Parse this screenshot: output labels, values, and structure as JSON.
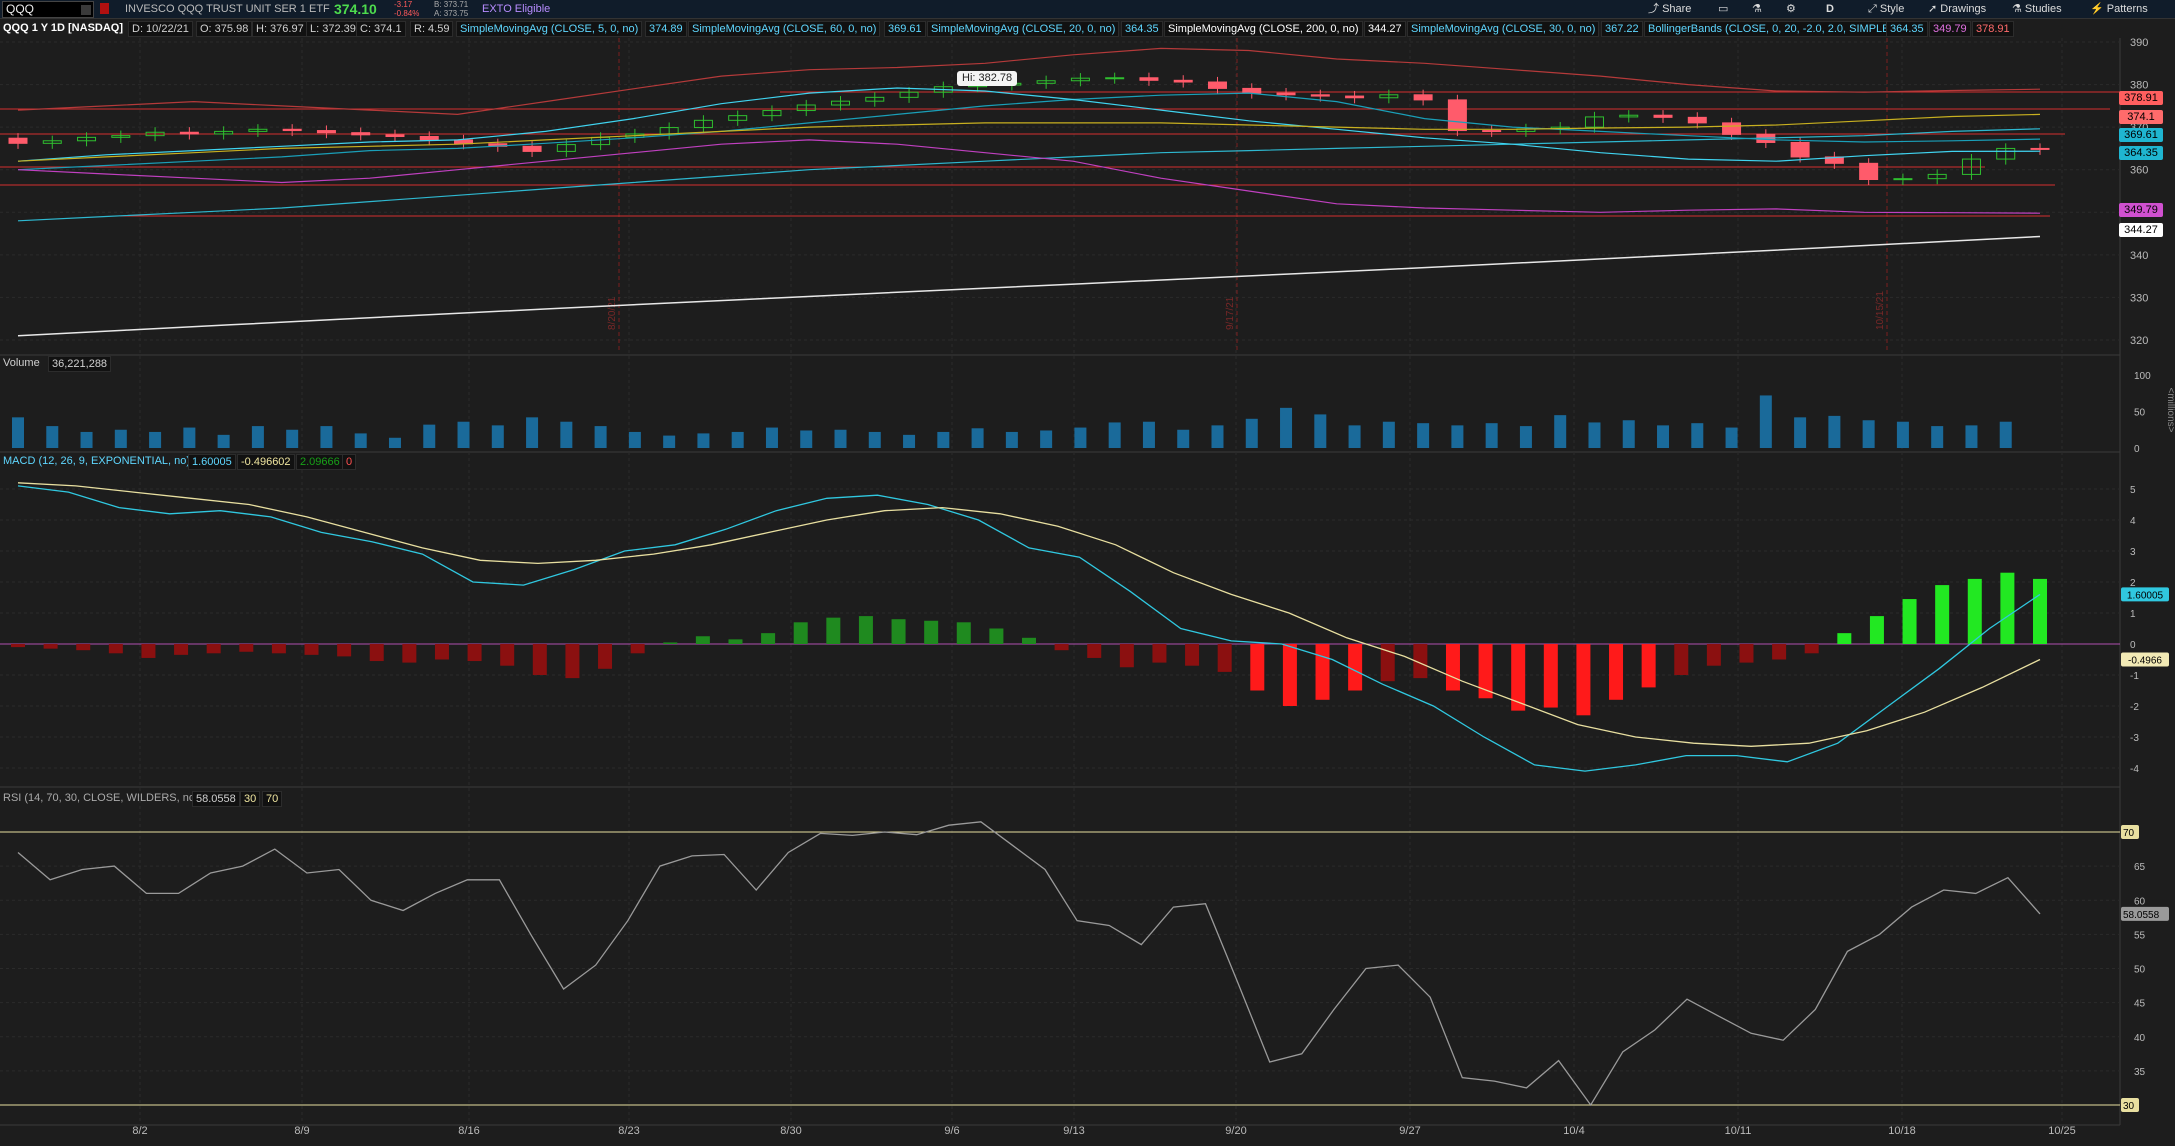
{
  "topbar": {
    "symbol": "QQQ",
    "description": "INVESCO QQQ TRUST UNIT SER 1 ETF",
    "last": "374.10",
    "change": "-3.17",
    "change_pct": "-0.84%",
    "bid": "B: 373.71",
    "ask": "A: 373.75",
    "exto": "EXTO Eligible",
    "share_label": "Share",
    "aggregation": "D",
    "style_label": "Style",
    "drawings_label": "Drawings",
    "studies_label": "Studies",
    "patterns_label": "Patterns"
  },
  "header": {
    "title": "QQQ 1 Y 1D [NASDAQ]",
    "date": "D: 10/22/21",
    "open": "O: 375.98",
    "high": "H: 376.97",
    "low": "L: 372.39",
    "close": "C: 374.1",
    "range": "R: 4.59",
    "studies": [
      {
        "name": "SimpleMovingAvg (CLOSE, 5, 0, no)",
        "value": "374.89",
        "color": "#5fd7ff"
      },
      {
        "name": "SimpleMovingAvg (CLOSE, 60, 0, no)",
        "value": "369.61",
        "color": "#5fd7ff"
      },
      {
        "name": "SimpleMovingAvg (CLOSE, 20, 0, no)",
        "value": "364.35",
        "color": "#5fd7ff"
      },
      {
        "name": "SimpleMovingAvg (CLOSE, 200, 0, no)",
        "value": "344.27",
        "color": "#ffffff"
      },
      {
        "name": "SimpleMovingAvg (CLOSE, 30, 0, no)",
        "value": "367.22",
        "color": "#5fd7ff"
      }
    ],
    "bollinger": {
      "name": "BollingerBands (CLOSE, 0, 20, -2.0, 2.0, SIMPLE)",
      "mid": "364.35",
      "lower": "349.79",
      "upper": "378.91"
    }
  },
  "price_chart": {
    "hi_label": "Hi: 382.78",
    "y_ticks": [
      "390",
      "380",
      "370",
      "360",
      "350",
      "340",
      "330",
      "320"
    ],
    "date_markers": [
      "8/20/21",
      "9/17/21",
      "10/15/21"
    ],
    "price_labels": [
      {
        "text": "378.91",
        "bg": "#ff5f5f",
        "fg": "#000"
      },
      {
        "text": "374.1",
        "bg": "#ff6b6b",
        "fg": "#000"
      },
      {
        "text": "369.61",
        "bg": "#1fb6d1",
        "fg": "#000"
      },
      {
        "text": "364.35",
        "bg": "#1fb6d1",
        "fg": "#000"
      },
      {
        "text": "349.79",
        "bg": "#d050d0",
        "fg": "#000"
      },
      {
        "text": "344.27",
        "bg": "#ffffff",
        "fg": "#000"
      }
    ]
  },
  "volume": {
    "label": "Volume",
    "value": "36,221,288",
    "y_ticks": [
      "100",
      "50",
      "0"
    ],
    "unit": "<millions>"
  },
  "macd": {
    "label": "MACD (12, 26, 9, EXPONENTIAL, no)",
    "value": "1.60005",
    "avg": "-0.496602",
    "diff": "2.09666",
    "zero": "0",
    "y_ticks": [
      "5",
      "4",
      "3",
      "2",
      "1",
      "0",
      "-1",
      "-2",
      "-3",
      "-4"
    ],
    "value_label": "1.60005",
    "avg_label": "-0.4966"
  },
  "rsi": {
    "label": "RSI (14, 70, 30, CLOSE, WILDERS, no)",
    "value": "58.0558",
    "ob": "30",
    "os": "70",
    "y_ticks": [
      "65",
      "60",
      "55",
      "50",
      "45",
      "40",
      "35"
    ],
    "upper_label": "70",
    "lower_label": "30",
    "value_label": "58.0558"
  },
  "x_axis": {
    "labels": [
      "8/2",
      "8/9",
      "8/16",
      "8/23",
      "8/30",
      "9/6",
      "9/13",
      "9/20",
      "9/27",
      "10/4",
      "10/11",
      "10/18",
      "10/25"
    ]
  }
}
